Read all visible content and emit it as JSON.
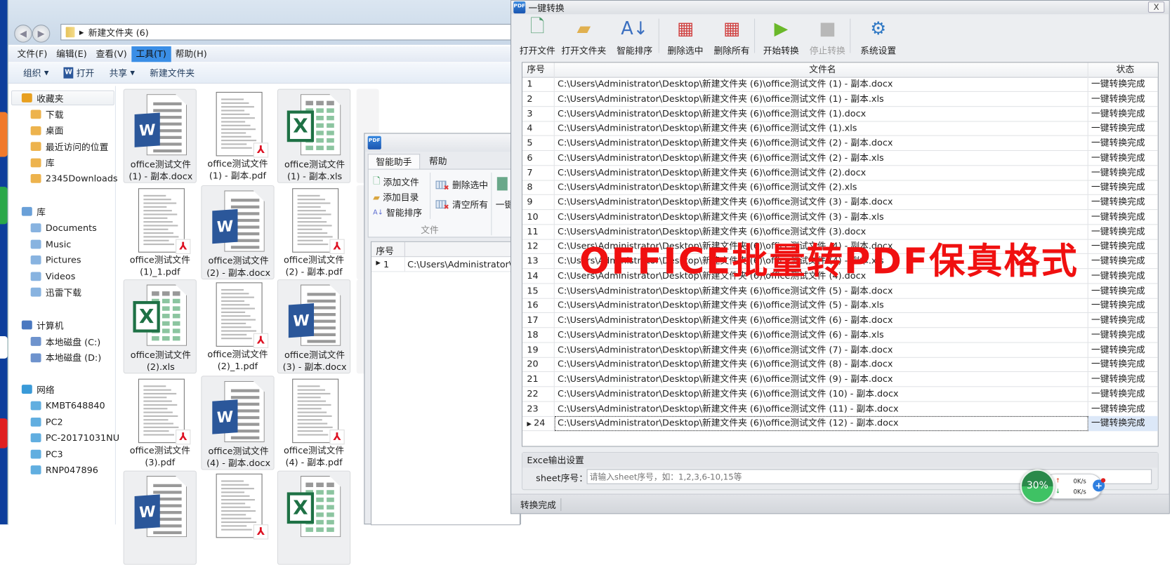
{
  "explorer": {
    "address": "新建文件夹 (6)",
    "menu": [
      "文件(F)",
      "编辑(E)",
      "查看(V)",
      "工具(T)",
      "帮助(H)"
    ],
    "menu_active_index": 3,
    "toolbar": {
      "organize": "组织",
      "open": "打开",
      "share": "共享",
      "new_folder": "新建文件夹"
    },
    "sidebar": {
      "favorites": {
        "label": "收藏夹",
        "items": [
          "下载",
          "桌面",
          "最近访问的位置",
          "库",
          "2345Downloads"
        ]
      },
      "libraries": {
        "label": "库",
        "items": [
          "Documents",
          "Music",
          "Pictures",
          "Videos",
          "迅雷下载"
        ]
      },
      "computer": {
        "label": "计算机",
        "items": [
          "本地磁盘 (C:)",
          "本地磁盘 (D:)"
        ]
      },
      "network": {
        "label": "网络",
        "items": [
          "KMBT648840",
          "PC2",
          "PC-20171031NU",
          "PC3",
          "RNP047896"
        ]
      }
    },
    "files": [
      {
        "type": "docx",
        "line1": "office测试文件",
        "line2": "(1) - 副本.docx",
        "selected": true
      },
      {
        "type": "pdf",
        "line1": "office测试文件",
        "line2": "(1) - 副本.pdf",
        "selected": false
      },
      {
        "type": "xls",
        "line1": "office测试文件",
        "line2": "(1) - 副本.xls",
        "selected": true
      },
      {
        "type": "pdf",
        "line1": "office测试文件",
        "line2": "(1)_1.pdf",
        "selected": false
      },
      {
        "type": "docx",
        "line1": "office测试文件",
        "line2": "(2) - 副本.docx",
        "selected": true
      },
      {
        "type": "pdf",
        "line1": "office测试文件",
        "line2": "(2) - 副本.pdf",
        "selected": false
      },
      {
        "type": "xls",
        "line1": "office测试文件",
        "line2": "(2).xls",
        "selected": true
      },
      {
        "type": "pdf",
        "line1": "office测试文件",
        "line2": "(2)_1.pdf",
        "selected": false
      },
      {
        "type": "docx",
        "line1": "office测试文件",
        "line2": "(3) - 副本.docx",
        "selected": true
      },
      {
        "type": "pdf",
        "line1": "office测试文件",
        "line2": "(3).pdf",
        "selected": false
      },
      {
        "type": "docx",
        "line1": "office测试文件",
        "line2": "(4) - 副本.docx",
        "selected": true
      },
      {
        "type": "pdf",
        "line1": "office测试文件",
        "line2": "(4) - 副本.pdf",
        "selected": false
      },
      {
        "type": "docx",
        "selected": true
      },
      {
        "type": "pdf",
        "selected": false
      },
      {
        "type": "xls",
        "selected": true
      }
    ]
  },
  "mini_window": {
    "tabs": [
      "智能助手",
      "帮助"
    ],
    "ribbon": {
      "add_file": "添加文件",
      "add_dir": "添加目录",
      "smart_sort": "智能排序",
      "delete_selected": "删除选中",
      "clear_all": "清空所有",
      "group_label": "文件",
      "one_click": "一键"
    },
    "grid_header": "序号",
    "row": {
      "index": "1",
      "path": "C:\\Users\\Administrator\\Des"
    }
  },
  "converter": {
    "title": "一键转换",
    "close": "X",
    "toolbar": [
      {
        "label": "打开文件",
        "icon": "add-file-icon"
      },
      {
        "label": "打开文件夹",
        "icon": "open-folder-icon"
      },
      {
        "label": "智能排序",
        "icon": "sort-az-icon"
      },
      {
        "label": "删除选中",
        "icon": "delete-selected-icon"
      },
      {
        "label": "删除所有",
        "icon": "delete-all-icon"
      },
      {
        "label": "开始转换",
        "icon": "play-icon"
      },
      {
        "label": "停止转换",
        "icon": "stop-icon",
        "disabled": true
      },
      {
        "label": "系统设置",
        "icon": "gear-icon"
      }
    ],
    "table": {
      "headers": [
        "序号",
        "文件名",
        "状态"
      ],
      "rows": [
        [
          "1",
          "C:\\Users\\Administrator\\Desktop\\新建文件夹 (6)\\office测试文件 (1) - 副本.docx",
          "一键转换完成"
        ],
        [
          "2",
          "C:\\Users\\Administrator\\Desktop\\新建文件夹 (6)\\office测试文件 (1) - 副本.xls",
          "一键转换完成"
        ],
        [
          "3",
          "C:\\Users\\Administrator\\Desktop\\新建文件夹 (6)\\office测试文件 (1).docx",
          "一键转换完成"
        ],
        [
          "4",
          "C:\\Users\\Administrator\\Desktop\\新建文件夹 (6)\\office测试文件 (1).xls",
          "一键转换完成"
        ],
        [
          "5",
          "C:\\Users\\Administrator\\Desktop\\新建文件夹 (6)\\office测试文件 (2) - 副本.docx",
          "一键转换完成"
        ],
        [
          "6",
          "C:\\Users\\Administrator\\Desktop\\新建文件夹 (6)\\office测试文件 (2) - 副本.xls",
          "一键转换完成"
        ],
        [
          "7",
          "C:\\Users\\Administrator\\Desktop\\新建文件夹 (6)\\office测试文件 (2).docx",
          "一键转换完成"
        ],
        [
          "8",
          "C:\\Users\\Administrator\\Desktop\\新建文件夹 (6)\\office测试文件 (2).xls",
          "一键转换完成"
        ],
        [
          "9",
          "C:\\Users\\Administrator\\Desktop\\新建文件夹 (6)\\office测试文件 (3) - 副本.docx",
          "一键转换完成"
        ],
        [
          "10",
          "C:\\Users\\Administrator\\Desktop\\新建文件夹 (6)\\office测试文件 (3) - 副本.xls",
          "一键转换完成"
        ],
        [
          "11",
          "C:\\Users\\Administrator\\Desktop\\新建文件夹 (6)\\office测试文件 (3).docx",
          "一键转换完成"
        ],
        [
          "12",
          "C:\\Users\\Administrator\\Desktop\\新建文件夹 (6)\\office测试文件 (4) - 副本.docx",
          "一键转换完成"
        ],
        [
          "13",
          "C:\\Users\\Administrator\\Desktop\\新建文件夹 (6)\\office测试文件 (4) - 副本.xls",
          "一键转换完成"
        ],
        [
          "14",
          "C:\\Users\\Administrator\\Desktop\\新建文件夹 (6)\\office测试文件 (4).docx",
          "一键转换完成"
        ],
        [
          "15",
          "C:\\Users\\Administrator\\Desktop\\新建文件夹 (6)\\office测试文件 (5) - 副本.docx",
          "一键转换完成"
        ],
        [
          "16",
          "C:\\Users\\Administrator\\Desktop\\新建文件夹 (6)\\office测试文件 (5) - 副本.xls",
          "一键转换完成"
        ],
        [
          "17",
          "C:\\Users\\Administrator\\Desktop\\新建文件夹 (6)\\office测试文件 (6) - 副本.docx",
          "一键转换完成"
        ],
        [
          "18",
          "C:\\Users\\Administrator\\Desktop\\新建文件夹 (6)\\office测试文件 (6) - 副本.xls",
          "一键转换完成"
        ],
        [
          "19",
          "C:\\Users\\Administrator\\Desktop\\新建文件夹 (6)\\office测试文件 (7) - 副本.docx",
          "一键转换完成"
        ],
        [
          "20",
          "C:\\Users\\Administrator\\Desktop\\新建文件夹 (6)\\office测试文件 (8) - 副本.docx",
          "一键转换完成"
        ],
        [
          "21",
          "C:\\Users\\Administrator\\Desktop\\新建文件夹 (6)\\office测试文件 (9) - 副本.docx",
          "一键转换完成"
        ],
        [
          "22",
          "C:\\Users\\Administrator\\Desktop\\新建文件夹 (6)\\office测试文件 (10) - 副本.docx",
          "一键转换完成"
        ],
        [
          "23",
          "C:\\Users\\Administrator\\Desktop\\新建文件夹 (6)\\office测试文件 (11) - 副本.docx",
          "一键转换完成"
        ],
        [
          "24",
          "C:\\Users\\Administrator\\Desktop\\新建文件夹 (6)\\office测试文件 (12) - 副本.docx",
          "一键转换完成"
        ]
      ],
      "selected_row": 24
    },
    "watermark": "OFFICE批量转PDF保真格式",
    "excel_group": {
      "title": "Exce输出设置",
      "sheet_label": "sheet序号：",
      "sheet_value": "",
      "sheet_placeholder": "请输入sheet序号，如：1,2,3,6-10,15等"
    },
    "status": "转换完成"
  },
  "speed_widget": {
    "percent": "30%",
    "upload": "0K/s",
    "download": "0K/s"
  },
  "colors": {
    "accent": "#3a8ee6",
    "watermark": "#f01010",
    "word": "#2b579a",
    "excel": "#1e7145",
    "widget_green": "#3fc264"
  }
}
